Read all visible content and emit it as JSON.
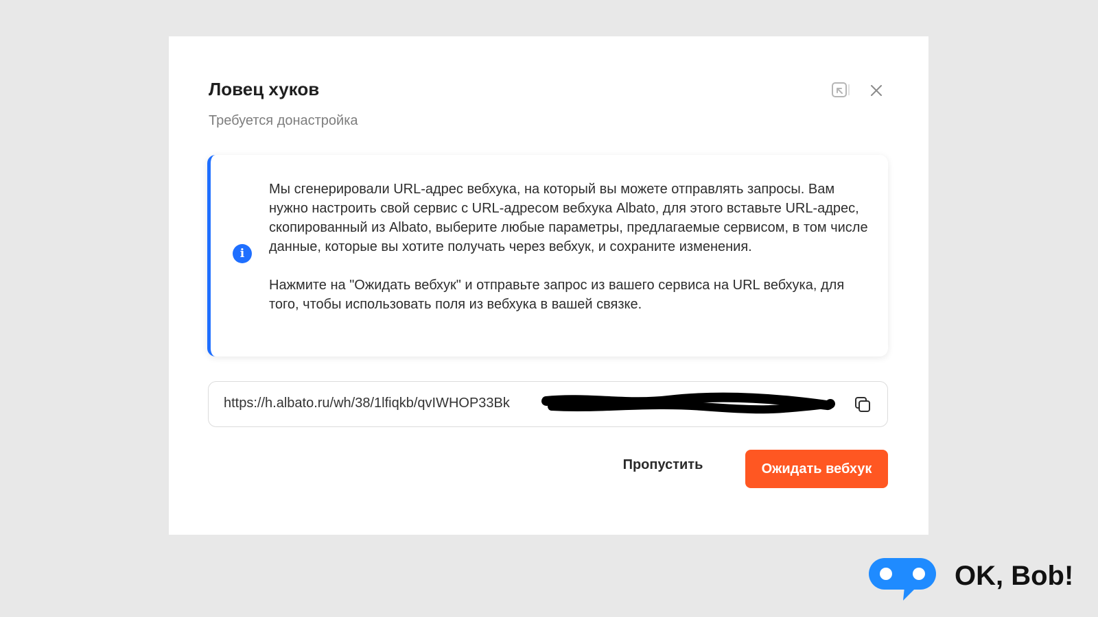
{
  "modal": {
    "title": "Ловец хуков",
    "subtitle": "Требуется донастройка",
    "expand_icon": "expand-window-icon",
    "close_icon": "close-icon"
  },
  "info": {
    "icon": "info-icon",
    "icon_glyph": "i",
    "accent_color": "#1f6fff",
    "paragraph_1": "Мы сгенерировали URL-адрес вебхука, на который вы можете отправлять запросы. Вам нужно настроить свой сервис с URL-адресом вебхука Albato, для этого вставьте URL-адрес, скопированный из Albato, выберите любые параметры, предлагаемые сервисом, в том числе данные, которые вы хотите получать через вебхук, и сохраните изменения.",
    "paragraph_2": "Нажмите на \"Ожидать вебхук\" и отправьте запрос из вашего сервиса на URL вебхука, для того, чтобы использовать поля из вебхука в вашей связке."
  },
  "webhook_url": {
    "value": "https://h.albato.ru/wh/38/1lfiqkb/qvIWHOP33Bk",
    "copy_icon": "copy-icon"
  },
  "actions": {
    "skip_label": "Пропустить",
    "wait_label": "Ожидать вебхук",
    "primary_color": "#ff5722"
  },
  "brand": {
    "text": "OK, Bob!",
    "logo_icon": "chat-bubble-icon",
    "logo_color": "#1f8bff"
  }
}
